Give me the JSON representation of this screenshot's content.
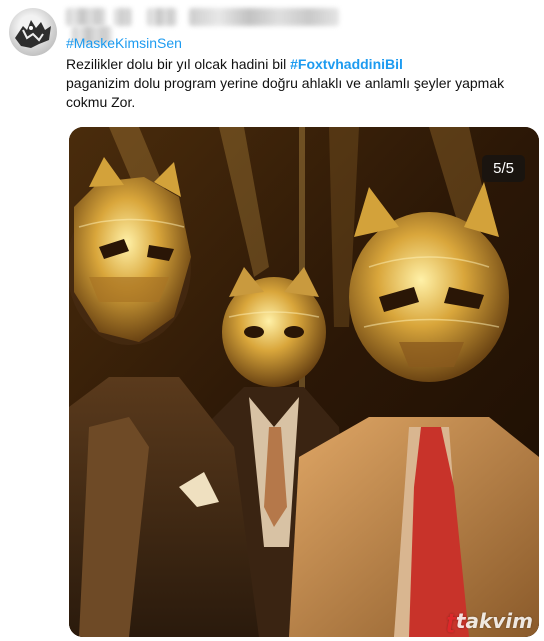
{
  "tweet": {
    "hashtag": "#MaskeKimsinSen",
    "line1_text": "Rezilikler dolu bir yıl olcak hadini bil",
    "line1_tag": "#FoxtvhaddiniBil",
    "body": "paganizim dolu program yerine doğru ahlaklı ve anlamlı şeyler yapmak cokmu Zor."
  },
  "media": {
    "counter": "5/5",
    "watermark": "takvim",
    "icon": "masked-men-photo"
  },
  "colors": {
    "link": "#1d9bf0",
    "brand_red": "#e3262b"
  }
}
